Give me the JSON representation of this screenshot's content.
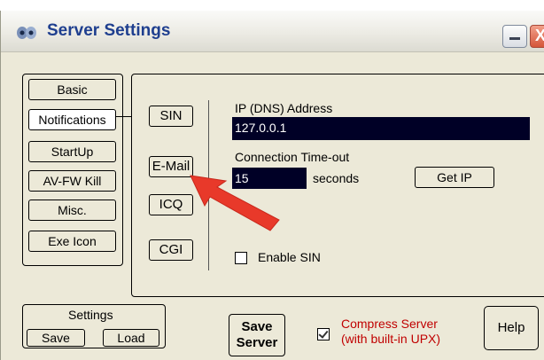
{
  "window": {
    "title": "Server Settings",
    "close_glyph": "X"
  },
  "nav": {
    "items": [
      {
        "label": "Basic",
        "active": false
      },
      {
        "label": "Notifications",
        "active": true
      },
      {
        "label": "StartUp",
        "active": false
      },
      {
        "label": "AV-FW Kill",
        "active": false
      },
      {
        "label": "Misc.",
        "active": false
      },
      {
        "label": "Exe Icon",
        "active": false
      }
    ]
  },
  "sub_nav": {
    "items": [
      {
        "label": "SIN"
      },
      {
        "label": "E-Mail"
      },
      {
        "label": "ICQ"
      },
      {
        "label": "CGI"
      }
    ]
  },
  "sin": {
    "ip_label": "IP (DNS) Address",
    "ip_value": "127.0.0.1",
    "timeout_label": "Connection Time-out",
    "timeout_value": "15",
    "timeout_unit": "seconds",
    "get_ip_label": "Get IP",
    "enable_label": "Enable SIN",
    "enable_checked": false
  },
  "settings_group": {
    "title": "Settings",
    "save_label": "Save",
    "load_label": "Load"
  },
  "footer": {
    "save_server_line1": "Save",
    "save_server_line2": "Server",
    "compress_line1": "Compress Server",
    "compress_line2": "(with built-in UPX)",
    "compress_checked": true,
    "help_label": "Help"
  },
  "colors": {
    "title_text": "#1f3f8f",
    "field_bg": "#000026",
    "compress_text": "#c00000",
    "annotation_arrow": "#e8392a"
  },
  "annotation": {
    "icon": "red-arrow-icon"
  }
}
